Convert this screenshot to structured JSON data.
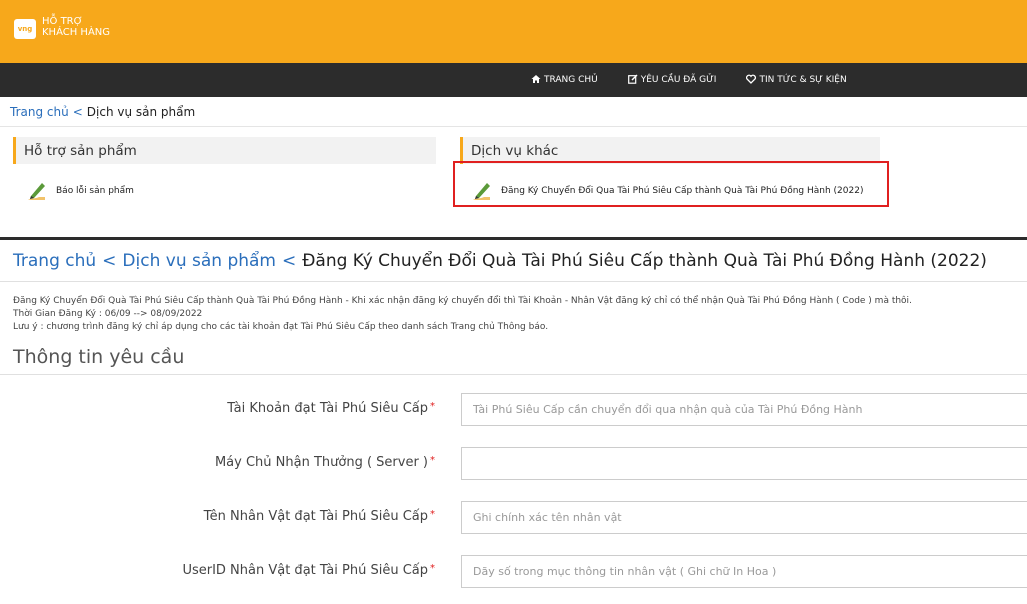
{
  "header": {
    "logo_badge": "vng",
    "logo_line1": "HỖ TRỢ",
    "logo_line2": "KHÁCH HÀNG"
  },
  "nav": {
    "items": [
      {
        "label": "TRANG CHỦ",
        "icon": "home-icon"
      },
      {
        "label": "YÊU CẦU ĐÃ GỬI",
        "icon": "edit-icon"
      },
      {
        "label": "TIN TỨC & SỰ KIỆN",
        "icon": "heart-icon"
      }
    ]
  },
  "breadcrumb1": {
    "home": "Trang chủ",
    "sep": "<",
    "current": "Dịch vụ sản phẩm"
  },
  "panels": {
    "left": {
      "title": "Hỗ trợ sản phẩm",
      "item": "Báo lỗi sản phẩm"
    },
    "right": {
      "title": "Dịch vụ khác",
      "item": "Đăng Ký Chuyển Đổi Qua Tài Phú Siêu Cấp thành Quà Tài Phú Đồng Hành (2022)"
    }
  },
  "breadcrumb2": {
    "home": "Trang chủ",
    "sep1": "<",
    "services": "Dịch vụ sản phẩm",
    "sep2": "<",
    "current": "Đăng Ký Chuyển Đổi Quà Tài Phú Siêu Cấp thành Quà Tài Phú Đồng Hành (2022)"
  },
  "notes": {
    "line1": "Đăng Ký Chuyển Đổi Quà Tài Phú Siêu Cấp thành Quà Tài Phú Đồng Hành - Khi xác nhận đăng ký chuyển đổi thì Tài Khoản - Nhân Vật đăng ký chỉ có thể nhận Quà Tài Phú Đồng Hành ( Code ) mà thôi.",
    "line2": "Thời Gian Đăng Ký : 06/09 --> 08/09/2022",
    "line3": "Lưu ý : chương trình đăng ký chỉ áp dụng cho các tài khoản đạt  Tài Phú Siêu Cấp theo danh sách Trang chủ Thông báo."
  },
  "form": {
    "section_title": "Thông tin yêu cầu",
    "required_mark": "*",
    "fields": [
      {
        "label": "Tài Khoản đạt Tài Phú Siêu Cấp",
        "placeholder": "Tài Phú Siêu Cấp cần chuyển đổi qua nhận quà của Tài Phú Đồng Hành",
        "value": ""
      },
      {
        "label": "Máy Chủ Nhận Thưởng ( Server )",
        "placeholder": "",
        "value": ""
      },
      {
        "label": "Tên Nhân Vật đạt Tài Phú Siêu Cấp",
        "placeholder": "Ghi chính xác tên nhân vật",
        "value": ""
      },
      {
        "label": "UserID Nhân Vật đạt Tài Phú Siêu Cấp",
        "placeholder": "Dãy số trong mục thông tin nhân vật ( Ghi chữ In Hoa )",
        "value": ""
      }
    ]
  },
  "colors": {
    "brand": "#f7a81b",
    "nav_bg": "#2c2c2c",
    "link": "#2a6ebb",
    "highlight": "#e02020"
  }
}
